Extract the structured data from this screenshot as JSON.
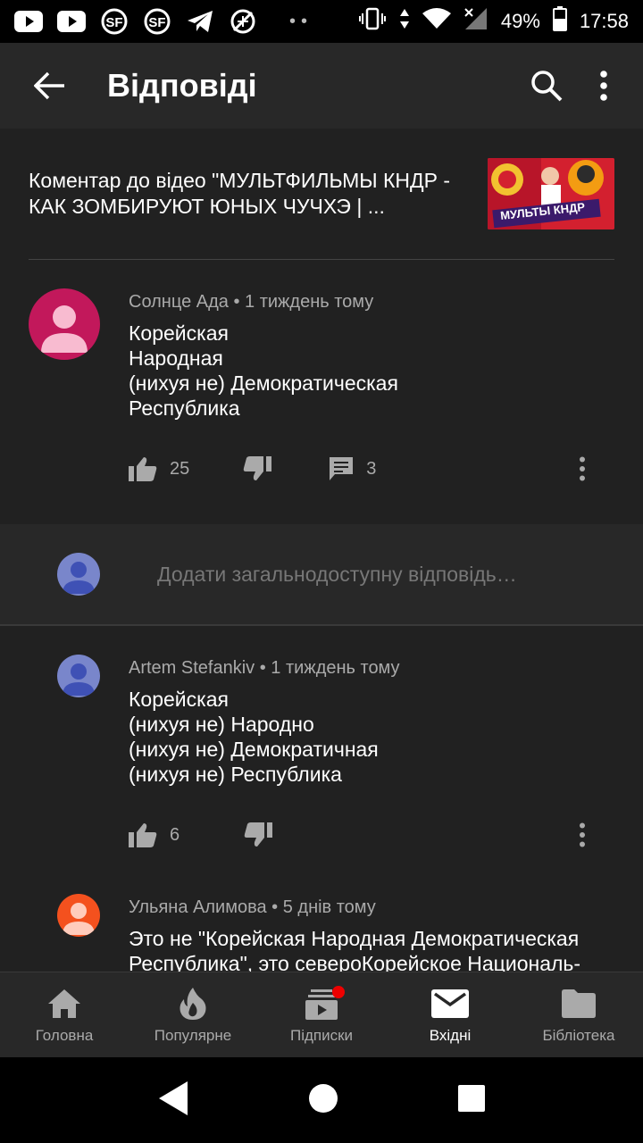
{
  "status_bar": {
    "battery": "49%",
    "time": "17:58",
    "left_icons": [
      "youtube-icon",
      "youtube-icon",
      "slow-food-icon",
      "slow-food-icon",
      "telegram-icon",
      "no-network-icon"
    ]
  },
  "app_bar": {
    "title": "Відповіді"
  },
  "video": {
    "text": "Коментар до відео \"МУЛЬТФИЛЬМЫ КНДР - КАК ЗОМБИРУЮТ ЮНЫХ ЧУЧХЭ | ...",
    "thumb_label": "МУЛЬТЫ КНДР"
  },
  "main_comment": {
    "author": "Солнце Ада",
    "time": "1 тиждень тому",
    "text": "Корейская\nНародная\n(нихуя не) Демократическая\nРеспублика",
    "likes": "25",
    "replies": "3",
    "avatar_color": "#c2185b"
  },
  "reply_box": {
    "placeholder": "Додати загальнодоступну відповідь…"
  },
  "replies": [
    {
      "author": "Artem Stefankiv",
      "time": "1 тиждень тому",
      "text": "Корейская\n(нихуя не) Народно\n(нихуя не) Демократичная\n(нихуя не) Республика",
      "likes": "6",
      "avatar_color": "#7986cb"
    },
    {
      "author": "Ульяна Алимова",
      "time": "5 днів тому",
      "text": "Это не \"Корейская Народная Демократическая Республика\", это североКорейское Националь-Демонческое Рабство!",
      "avatar_color": "#f4511e"
    }
  ],
  "bottom_nav": [
    {
      "label": "Головна",
      "icon": "home-icon"
    },
    {
      "label": "Популярне",
      "icon": "trending-icon"
    },
    {
      "label": "Підписки",
      "icon": "subscriptions-icon"
    },
    {
      "label": "Вхідні",
      "icon": "inbox-icon"
    },
    {
      "label": "Бібліотека",
      "icon": "library-icon"
    }
  ],
  "colors": {
    "background": "#212121",
    "surface": "#282828",
    "accent": "#e00000"
  }
}
